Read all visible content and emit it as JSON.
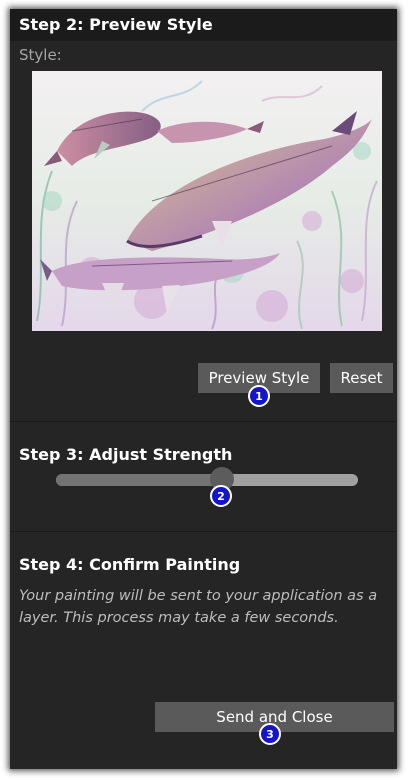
{
  "step2": {
    "title": "Step 2: Preview Style",
    "style_label": "Style:",
    "preview_button": "Preview Style",
    "reset_button": "Reset"
  },
  "step3": {
    "title": "Step 3: Adjust Strength",
    "strength_fraction": 0.55
  },
  "step4": {
    "title": "Step 4: Confirm Painting",
    "description": "Your painting will be sent to your application as a layer. This process may take a few seconds.",
    "send_button": "Send and Close"
  },
  "badges": [
    "1",
    "2",
    "3"
  ],
  "colors": {
    "panel_bg": "#252525",
    "header_bg": "#1b1b1b",
    "button_bg": "#5a5a5a",
    "badge_bg": "#1414c8"
  }
}
